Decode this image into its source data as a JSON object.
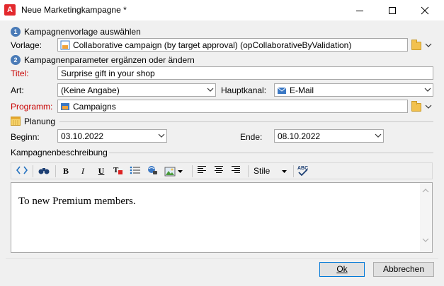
{
  "window": {
    "app_icon": "A",
    "title": "Neue Marketingkampagne *"
  },
  "step1": {
    "number": "1",
    "heading": "Kampagnenvorlage auswählen",
    "template_label": "Vorlage:",
    "template_value": "Collaborative campaign (by target approval) (opCollaborativeByValidation)"
  },
  "step2": {
    "number": "2",
    "heading": "Kampagnenparameter ergänzen oder ändern",
    "title_label": "Titel:",
    "title_value": "Surprise gift in your shop",
    "type_label": "Art:",
    "type_value": "(Keine Angabe)",
    "channel_label": "Hauptkanal:",
    "channel_value": "E-Mail",
    "program_label": "Programm:",
    "program_value": "Campaigns"
  },
  "planning": {
    "heading": "Planung",
    "start_label": "Beginn:",
    "start_value": "03.10.2022",
    "end_label": "Ende:",
    "end_value": "08.10.2022"
  },
  "description": {
    "heading": "Kampagnenbeschreibung",
    "toolbar": {
      "bold": "B",
      "italic": "I",
      "underline": "U",
      "style_select": "Stile",
      "spellcheck": "ABC"
    },
    "text": "To new Premium members."
  },
  "buttons": {
    "ok": "Ok",
    "cancel": "Abbrechen"
  },
  "colors": {
    "required_label": "#c80000",
    "step_badge": "#4a7bb7",
    "default_button_border": "#0078d7"
  }
}
